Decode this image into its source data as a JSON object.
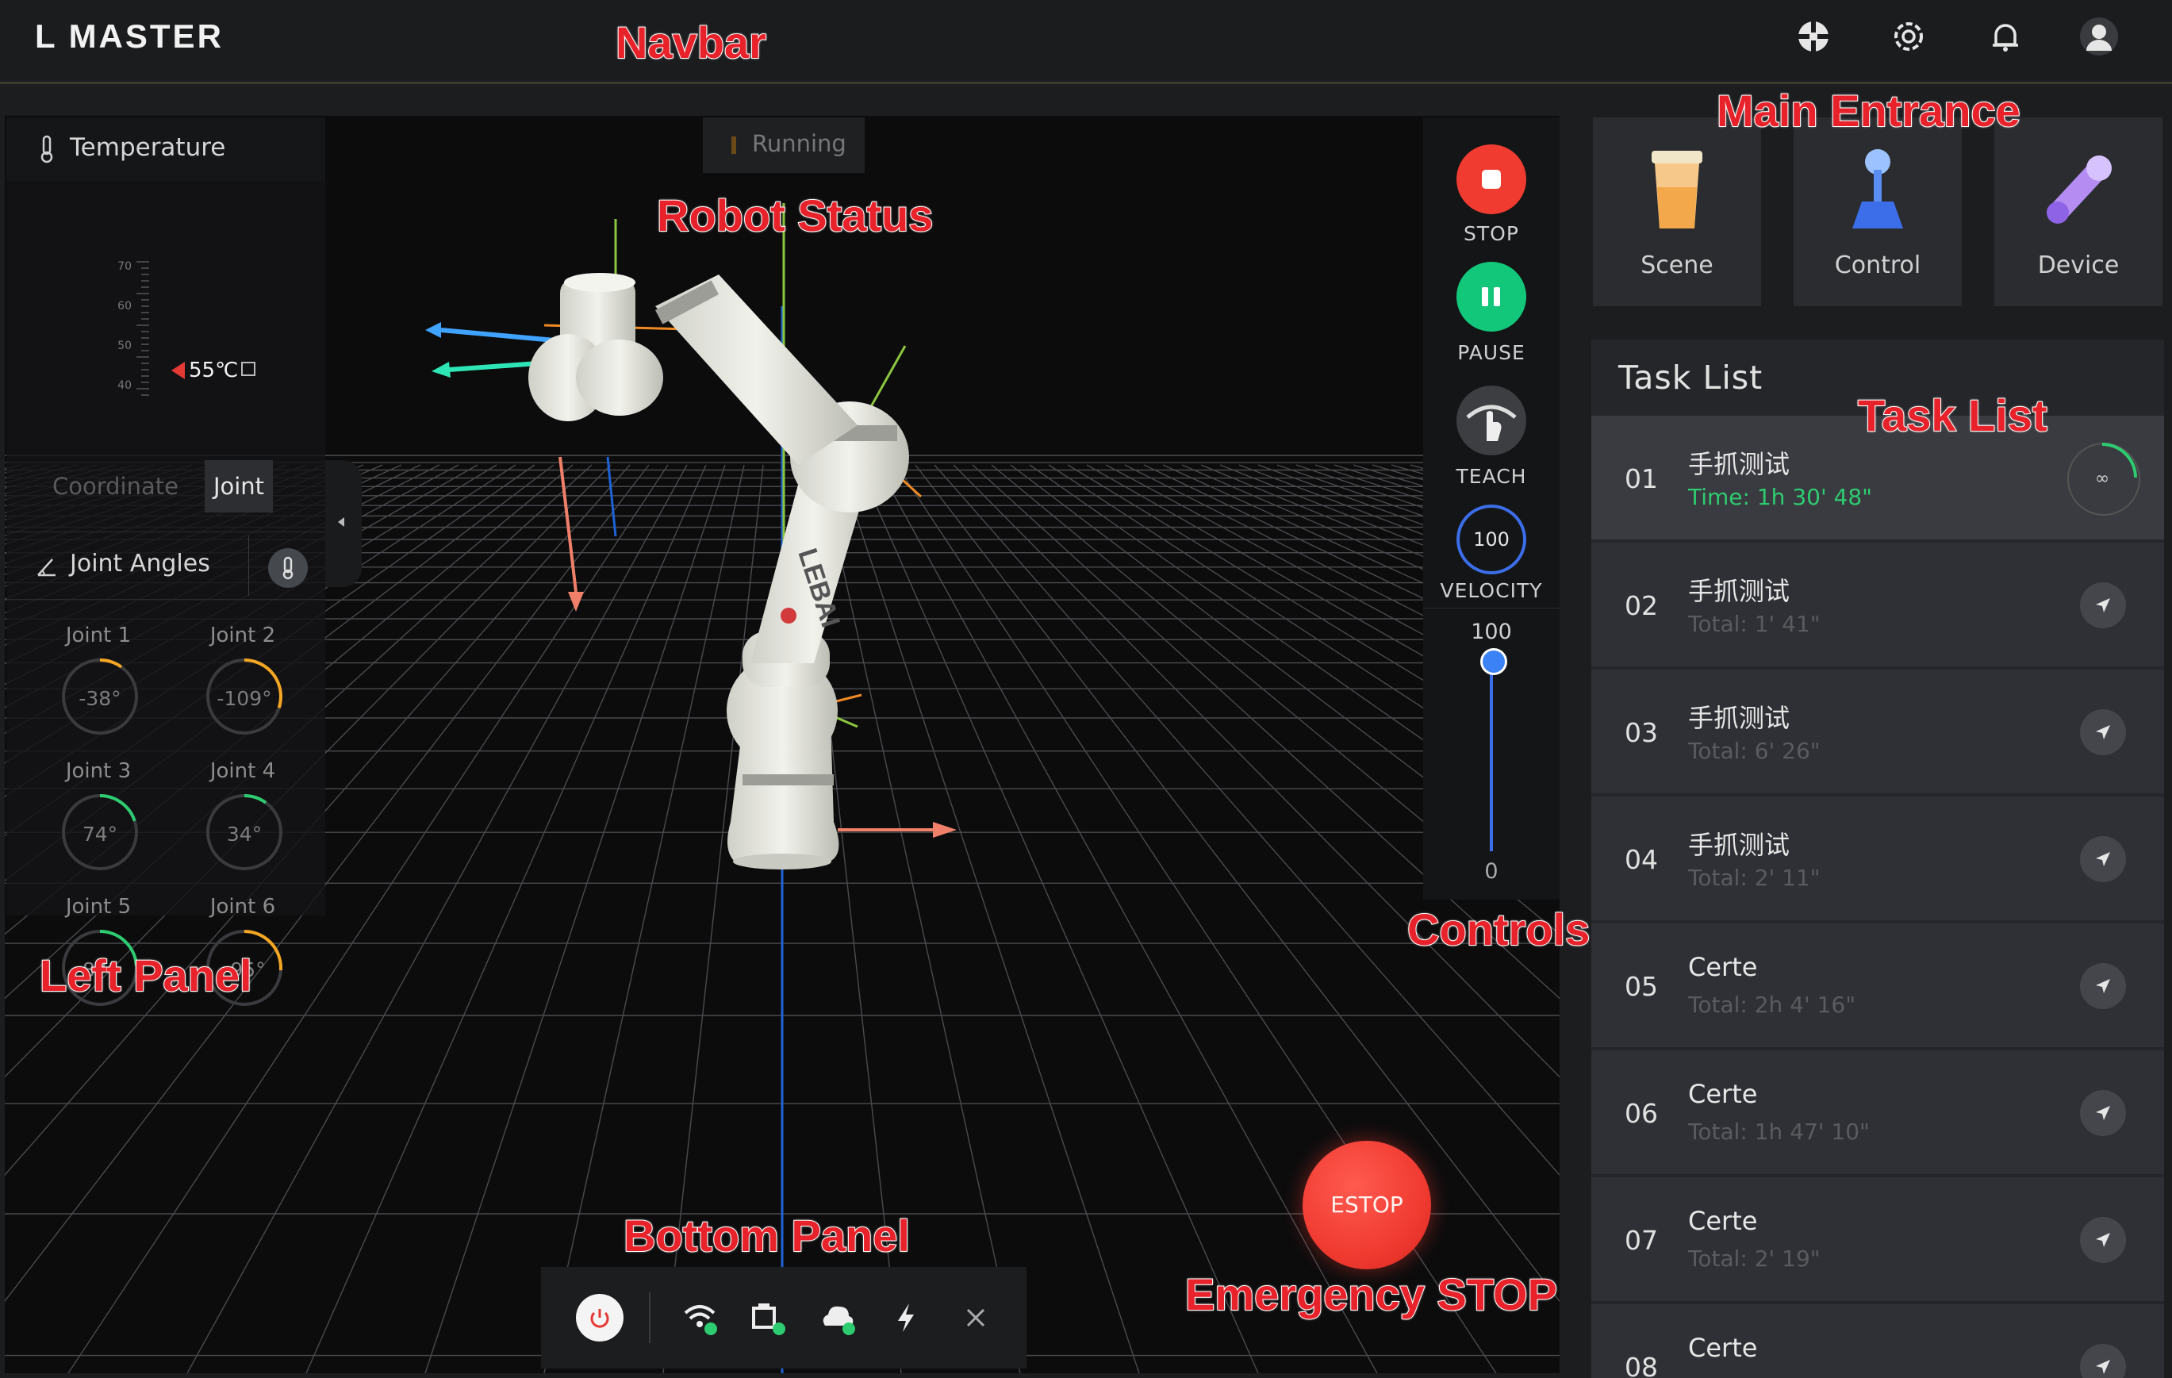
{
  "navbar": {
    "brand": "L MASTER",
    "icons": [
      "target-icon",
      "gear-icon",
      "bell-icon",
      "user-avatar-icon"
    ]
  },
  "annotations": {
    "navbar": "Navbar",
    "main_entrance": "Main Entrance",
    "robot_status": "Robot Status",
    "task_list": "Task List",
    "left_panel": "Left Panel",
    "controls": "Controls",
    "bottom_panel": "Bottom Panel",
    "emergency_stop": "Emergency STOP"
  },
  "left_panel": {
    "title": "Temperature",
    "scale": [
      "70",
      "60",
      "50",
      "40"
    ],
    "temperature": "55℃",
    "tabs": {
      "coordinate": "Coordinate",
      "joint": "Joint"
    },
    "joint_angles_title": "Joint Angles",
    "joints": [
      {
        "label": "Joint 1",
        "value": "-38°",
        "level": 0.1,
        "color": "#f5a623"
      },
      {
        "label": "Joint 2",
        "value": "-109°",
        "level": 0.3,
        "color": "#f5a623"
      },
      {
        "label": "Joint 3",
        "value": "74°",
        "level": 0.2,
        "color": "#2ecc71"
      },
      {
        "label": "Joint 4",
        "value": "34°",
        "level": 0.1,
        "color": "#2ecc71"
      },
      {
        "label": "Joint 5",
        "value": "87°",
        "level": 0.24,
        "color": "#2ecc71"
      },
      {
        "label": "Joint 6",
        "value": "-95°",
        "level": 0.26,
        "color": "#f5a623"
      }
    ]
  },
  "robot_status": {
    "text": "Running"
  },
  "controls": {
    "stop": "STOP",
    "pause": "PAUSE",
    "teach": "TEACH",
    "velocity_value": "100",
    "velocity_label": "VELOCITY",
    "slider_max": "100",
    "slider_min": "0",
    "slider_level": 1.0,
    "stop_color": "#f03b31",
    "pause_color": "#12c77a"
  },
  "estop": {
    "label": "ESTOP"
  },
  "main_entrance": [
    {
      "label": "Scene",
      "icon": "cup-icon"
    },
    {
      "label": "Control",
      "icon": "joystick-icon"
    },
    {
      "label": "Device",
      "icon": "robot-arm-icon"
    }
  ],
  "task_list": {
    "title": "Task List",
    "items": [
      {
        "num": "01",
        "name": "手抓测试",
        "time": "Time: 1h 30' 48\"",
        "active": true
      },
      {
        "num": "02",
        "name": "手抓测试",
        "time": "Total: 1' 41\""
      },
      {
        "num": "03",
        "name": "手抓测试",
        "time": "Total: 6' 26\""
      },
      {
        "num": "04",
        "name": "手抓测试",
        "time": "Total: 2' 11\""
      },
      {
        "num": "05",
        "name": "Certe",
        "time": "Total: 2h 4' 16\""
      },
      {
        "num": "06",
        "name": "Certe",
        "time": "Total: 1h 47' 10\""
      },
      {
        "num": "07",
        "name": "Certe",
        "time": "Total: 2' 19\""
      },
      {
        "num": "08",
        "name": "Certe",
        "time": ""
      }
    ]
  },
  "bottom_panel": {
    "icons": [
      "power-icon",
      "wifi-icon",
      "network-icon",
      "cloud-icon",
      "lightning-icon",
      "close-icon"
    ],
    "status_color": "#2ecc71"
  }
}
